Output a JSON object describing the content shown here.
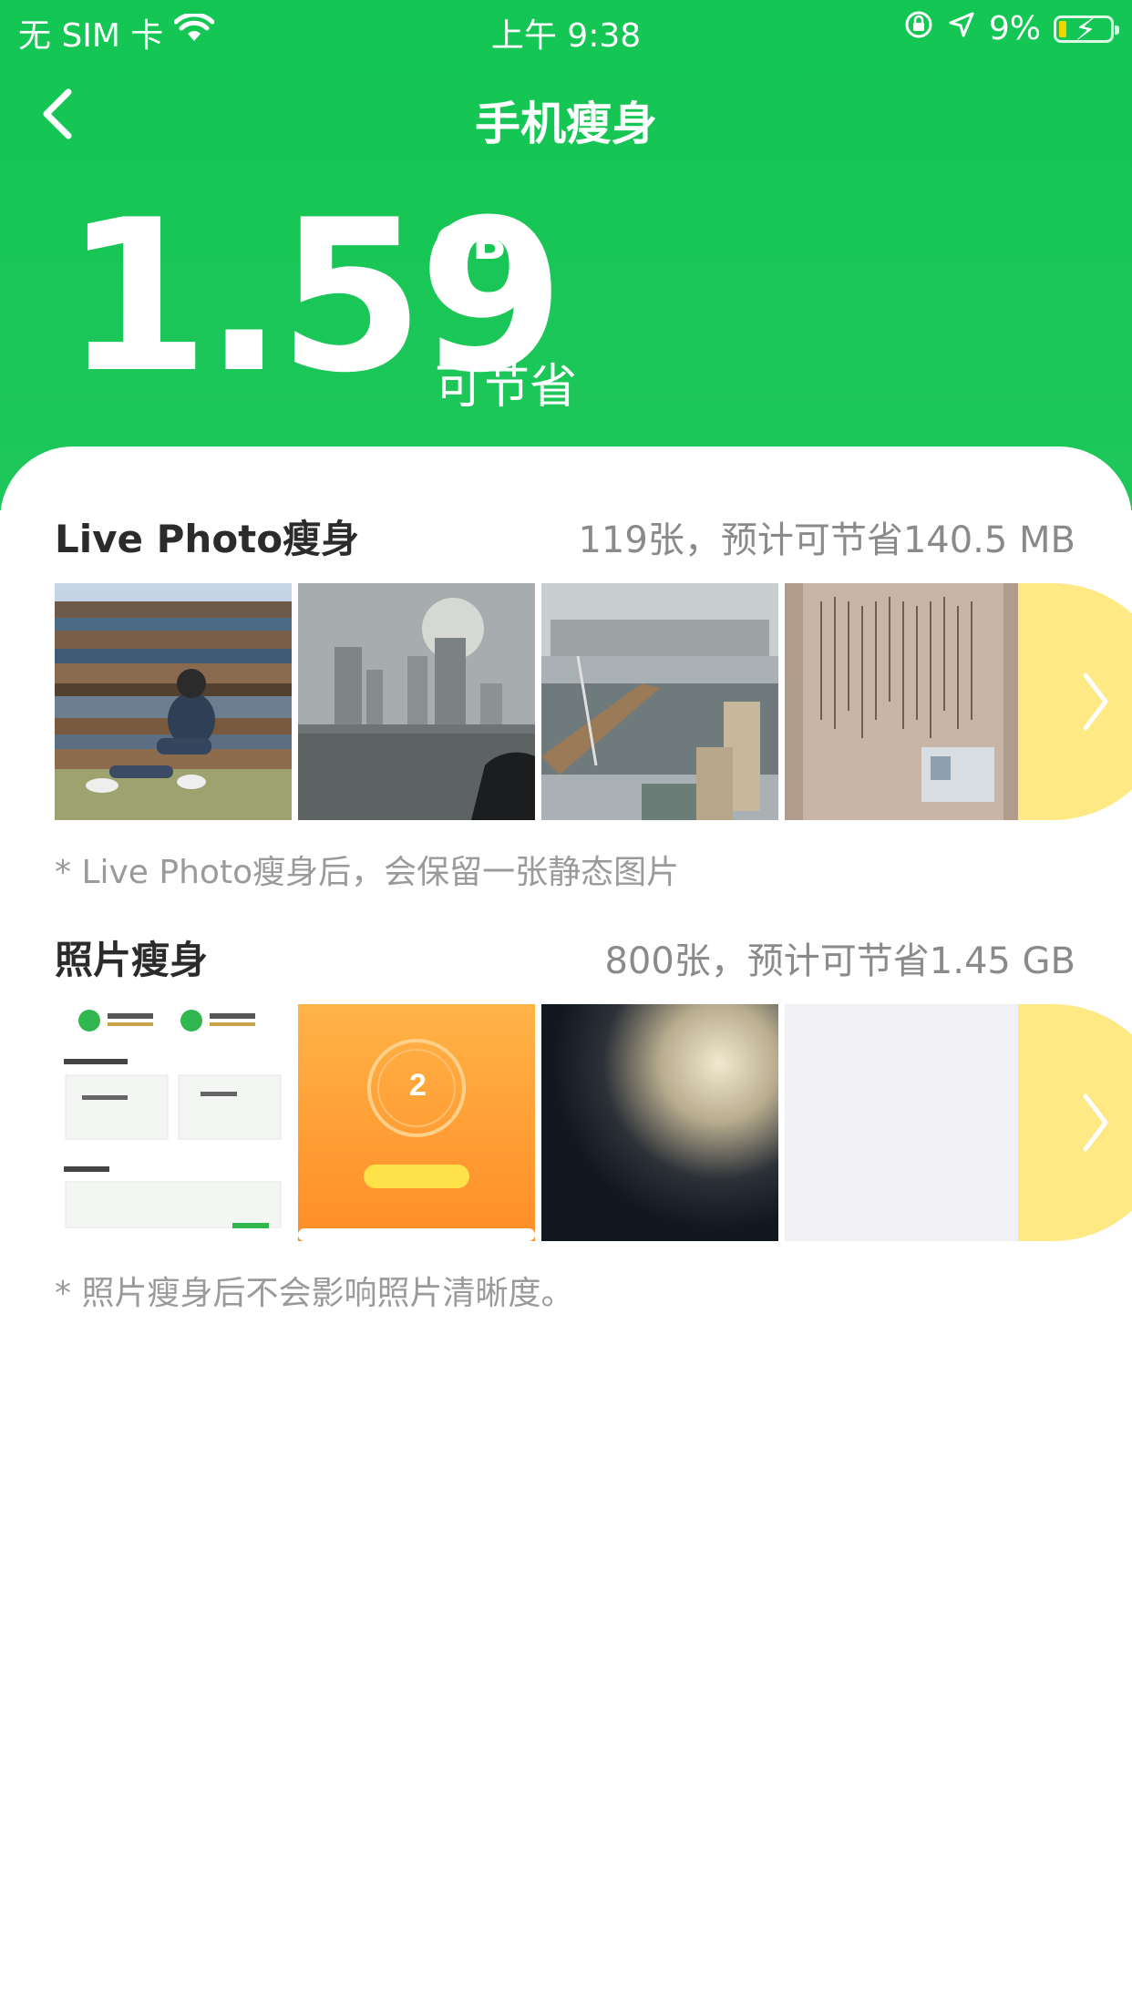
{
  "status_bar": {
    "carrier": "无 SIM 卡",
    "time": "上午 9:38",
    "battery": "9%",
    "icons": [
      "wifi-icon",
      "orientation-lock-icon",
      "location-arrow-icon",
      "battery-charging-icon"
    ]
  },
  "nav": {
    "title": "手机瘦身",
    "back_icon": "chevron-left-icon"
  },
  "summary": {
    "value": "1.59",
    "unit": "GB",
    "label": "可节省"
  },
  "live_photo": {
    "title": "Live Photo瘦身",
    "meta": "119张，预计可节省140.5 MB",
    "note": "* Live Photo瘦身后，会保留一张静态图片",
    "thumbnails": [
      "photo-person-sitting-on-wood",
      "photo-hazy-skyline",
      "photo-city-bridge",
      "photo-document-page"
    ],
    "more_icon": "chevron-right-icon"
  },
  "photo": {
    "title": "照片瘦身",
    "meta": "800张，预计可节省1.45 GB",
    "note": "* 照片瘦身后不会影响照片清晰度。",
    "thumbnails": [
      "screenshot-app-menu",
      "screenshot-orange-card",
      "photo-dark-blur",
      "photo-blank-gray"
    ],
    "more_icon": "chevron-right-icon"
  },
  "colors": {
    "brand_green": "#13c653",
    "more_button": "#fee985",
    "card_bg": "#ffffff"
  }
}
